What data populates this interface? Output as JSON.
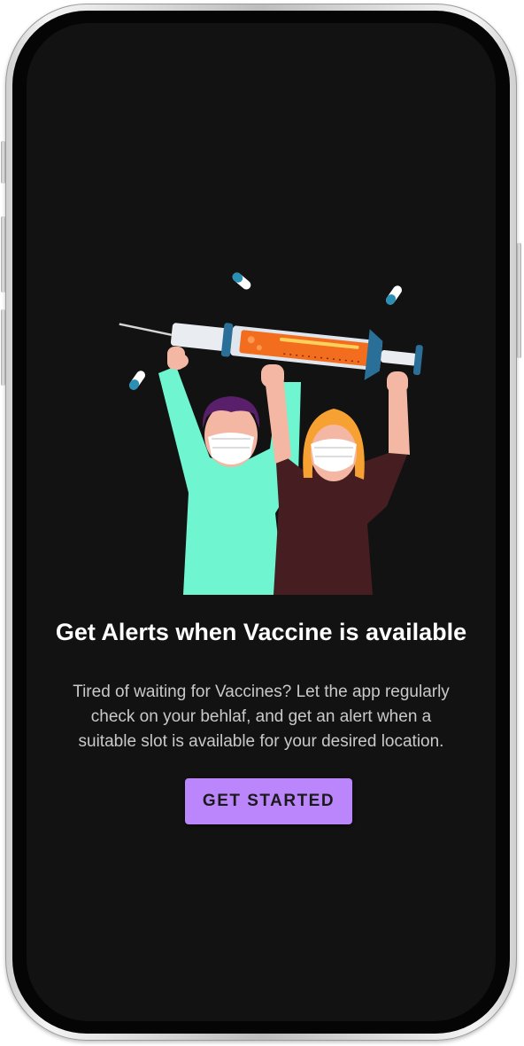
{
  "onboarding": {
    "title": "Get Alerts when Vaccine is available",
    "description": "Tired of waiting for Vaccines? Let the app regularly check on your behlaf, and get an alert when a suitable slot is available for your desired location.",
    "cta_label": "GET STARTED"
  },
  "colors": {
    "background": "#121212",
    "accent": "#bb86fc",
    "title_text": "#ffffff",
    "body_text": "#c9c9c9"
  },
  "icons": {
    "illustration": "people-holding-vaccine-syringe-illustration"
  }
}
